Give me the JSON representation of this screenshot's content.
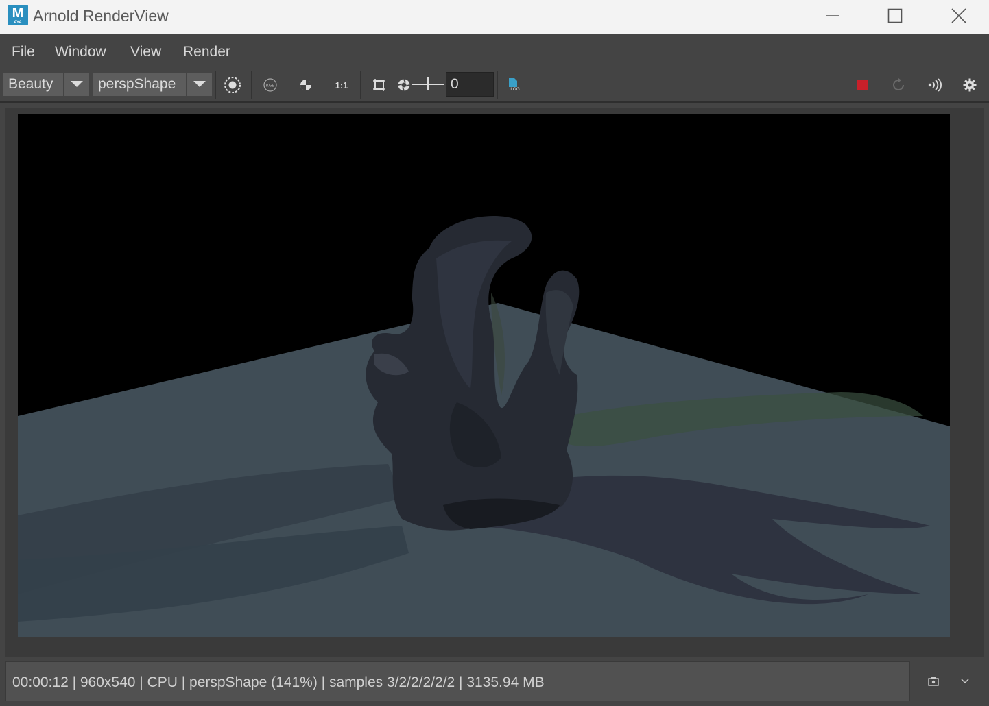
{
  "window": {
    "title": "Arnold RenderView",
    "app_icon_letter": "M",
    "app_icon_sub": "AYA"
  },
  "menu": [
    "File",
    "Window",
    "View",
    "Render"
  ],
  "toolbar": {
    "aov_combo": "Beauty",
    "camera_combo": "perspShape",
    "ratio_label": "1:1",
    "exposure_value": "0",
    "log_label": "LOG",
    "rgb_label": "RGB"
  },
  "status": {
    "text": "00:00:12 | 960x540 | CPU | perspShape (141%) | samples 3/2/2/2/2/2 | 3135.94 MB"
  },
  "colors": {
    "stop_render": "#c8202a",
    "background": "#444444",
    "titlebar": "#f3f3f3"
  },
  "icons": [
    "app-icon",
    "minimize-icon",
    "maximize-icon",
    "close-icon",
    "dropdown-arrow-icon",
    "isolate-region-icon",
    "rgb-channel-icon",
    "checker-icon",
    "crop-region-icon",
    "exposure-icon",
    "log-file-icon",
    "stop-icon",
    "refresh-icon",
    "ipr-icon",
    "gear-icon",
    "snapshot-icon",
    "chevron-down-icon"
  ]
}
